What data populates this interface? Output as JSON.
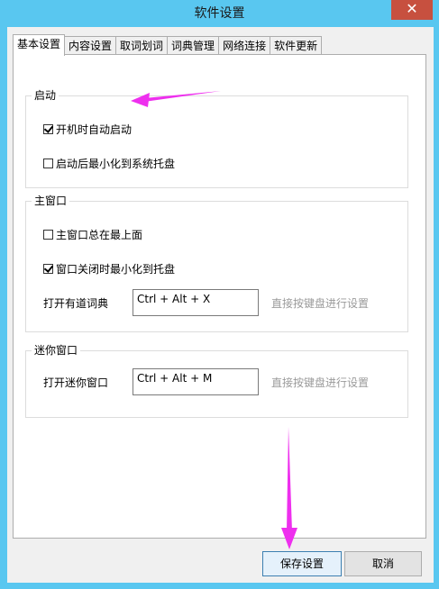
{
  "window": {
    "title": "软件设置",
    "close_label": "✕"
  },
  "tabs": [
    {
      "label": "基本设置",
      "active": true
    },
    {
      "label": "内容设置",
      "active": false
    },
    {
      "label": "取词划词",
      "active": false
    },
    {
      "label": "词典管理",
      "active": false
    },
    {
      "label": "网络连接",
      "active": false
    },
    {
      "label": "软件更新",
      "active": false
    }
  ],
  "startup": {
    "title": "启动",
    "autostart": {
      "label": "开机时自动启动",
      "checked": true
    },
    "minimize_tray": {
      "label": "启动后最小化到系统托盘",
      "checked": false
    }
  },
  "main_window": {
    "title": "主窗口",
    "always_on_top": {
      "label": "主窗口总在最上面",
      "checked": false
    },
    "close_to_tray": {
      "label": "窗口关闭时最小化到托盘",
      "checked": true
    },
    "open_hotkey": {
      "label": "打开有道词典",
      "value": "Ctrl + Alt + X",
      "hint": "直接按键盘进行设置"
    }
  },
  "mini_window": {
    "title": "迷你窗口",
    "open_hotkey": {
      "label": "打开迷你窗口",
      "value": "Ctrl + Alt + M",
      "hint": "直接按键盘进行设置"
    }
  },
  "footer": {
    "save_label": "保存设置",
    "cancel_label": "取消"
  },
  "colors": {
    "titlebar": "#59c7f0",
    "close_button": "#c7503f",
    "annotation_arrow": "#ee2fee"
  }
}
